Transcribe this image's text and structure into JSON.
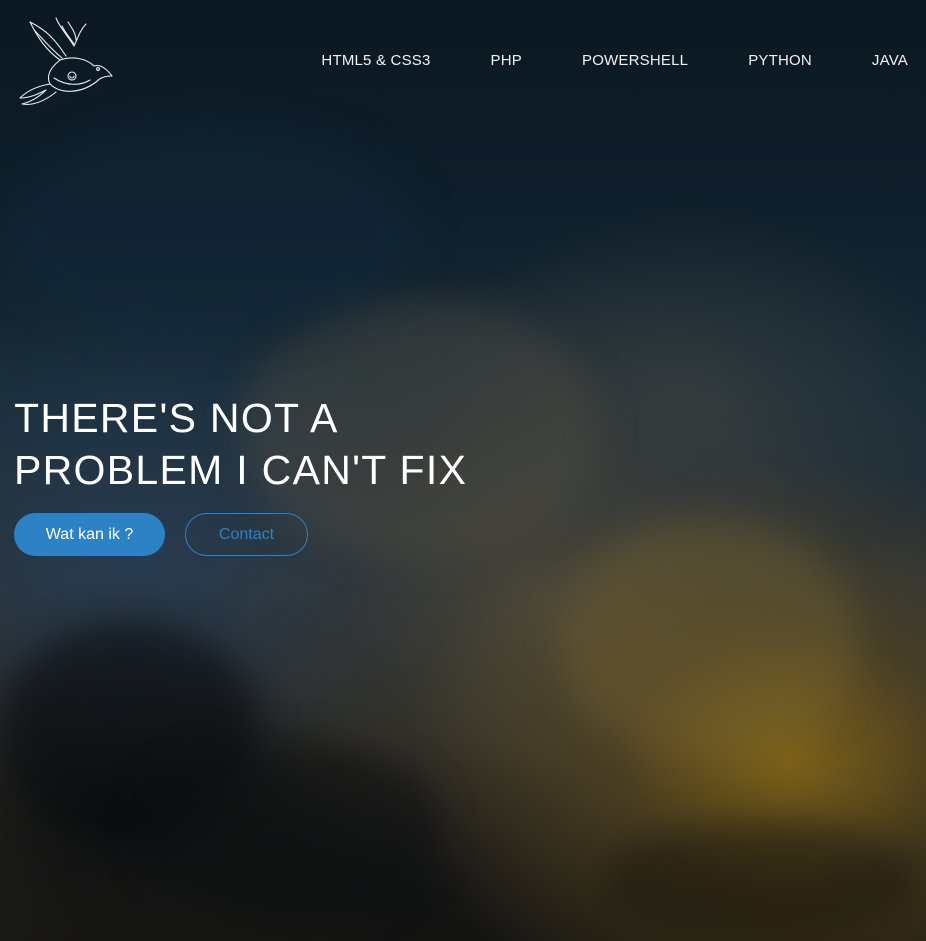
{
  "header": {
    "logo_icon": "swallow-bird-icon",
    "nav": [
      {
        "label": "HTML5 & CSS3"
      },
      {
        "label": "PHP"
      },
      {
        "label": "POWERSHELL"
      },
      {
        "label": "PYTHON"
      },
      {
        "label": "JAVA"
      }
    ]
  },
  "hero": {
    "title_line1": "THERE'S NOT A",
    "title_line2": "PROBLEM I CAN'T FIX",
    "primary_button": "Wat kan ik ?",
    "secondary_button": "Contact"
  },
  "colors": {
    "accent": "#2d82c6",
    "text": "#ffffff"
  }
}
